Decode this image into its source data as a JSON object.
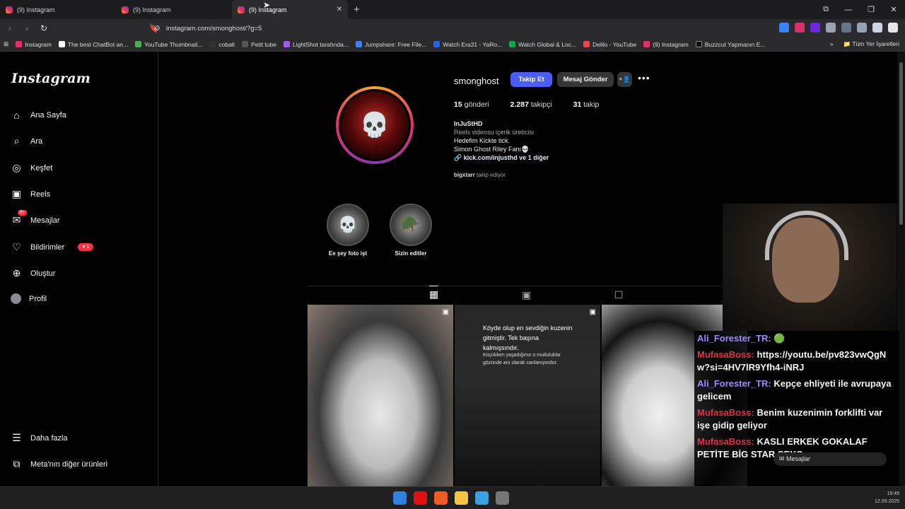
{
  "browser": {
    "tabs": [
      {
        "title": "(9) Instagram"
      },
      {
        "title": "(9) Instagram"
      },
      {
        "title": "(9) Instagram"
      }
    ],
    "url": "instagram.com/smonghost/?g=5",
    "bookmarks": [
      "Instagram",
      "The best ChatBot an...",
      "YouTube Thumbnail...",
      "cobalt",
      "Petit tube",
      "LightShot tarafında...",
      "Jumpshare: Free File...",
      "Watch Era31 - YaRo...",
      "Watch Global & Loc...",
      "Delilo - YouTube",
      "(9) Instagram",
      "Buzzcut Yapmanın E..."
    ],
    "all_bookmarks": "Tüm Yer İşaretleri"
  },
  "sidebar": {
    "logo": "Instagram",
    "items": [
      {
        "label": "Ana Sayfa",
        "icon": "home-icon"
      },
      {
        "label": "Ara",
        "icon": "search-icon"
      },
      {
        "label": "Keşfet",
        "icon": "compass-icon"
      },
      {
        "label": "Reels",
        "icon": "reels-icon"
      },
      {
        "label": "Mesajlar",
        "icon": "messenger-icon",
        "badge": "9+"
      },
      {
        "label": "Bildirimler",
        "icon": "heart-icon",
        "badge": "1"
      },
      {
        "label": "Oluştur",
        "icon": "plus-icon"
      },
      {
        "label": "Profil",
        "icon": "avatar-icon"
      }
    ],
    "more": "Daha fazla",
    "meta": "Meta'nın diğer ürünleri"
  },
  "profile": {
    "username": "smonghost",
    "follow_label": "Takip Et",
    "message_label": "Mesaj Gönder",
    "posts_count": "15",
    "posts_label": "gönderi",
    "followers_count": "2.287",
    "followers_label": "takipçi",
    "following_count": "31",
    "following_label": "takip",
    "display_name": "InJuStHD",
    "category": "Reels videosu içerik üreticisi",
    "bio_line1": "Hedefim Kickte tick.",
    "bio_line2": "Simon Ghost Riley Fanı💀",
    "link": "kick.com/injusthd ve 1 diğer",
    "followed_by_user": "bigxtarr",
    "followed_by_text": "takip ediyor",
    "highlights": [
      {
        "label": "Ee şey foto işt"
      },
      {
        "label": "Sizin editler"
      }
    ],
    "post2_caption1": "Köyde olup  en sevdiğin kuzenin gitmiştir. Tek başına kalmışsındır.",
    "post2_caption2": "Küçükken yaşadığınız o mutluluklar gözünde anı olarak canlanıyordur."
  },
  "chat": {
    "messages": [
      {
        "user": "Ali_Forester_TR:",
        "text": " 🟢"
      },
      {
        "user": "MufasaBoss:",
        "text": " https://youtu.be/pv823vwQgNw?si=4HV7lR9Yfh4-iNRJ"
      },
      {
        "user": "Ali_Forester_TR:",
        "text": " Kepçe ehliyeti ile avrupaya gelicem"
      },
      {
        "user": "MufasaBoss:",
        "text": " Benim kuzenimin forklifti var işe gidip geliyor"
      },
      {
        "user": "MufasaBoss:",
        "text": " KASLI ERKEK GOKALAF PETİTE BİG STAR SEKS"
      }
    ],
    "mesajlar_label": "Mesajlar"
  },
  "taskbar": {
    "time": "19:49",
    "date": "12.09.2025"
  }
}
